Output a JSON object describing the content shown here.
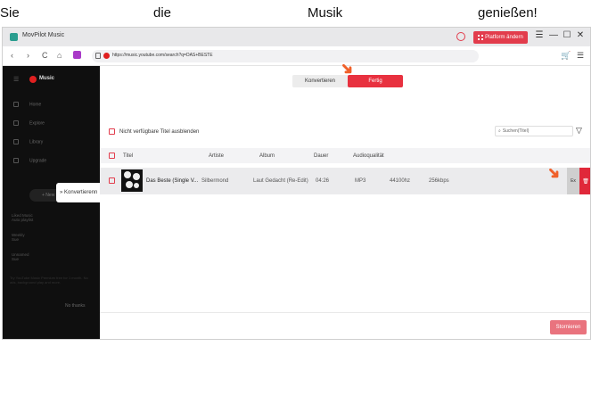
{
  "captions": [
    "Sie",
    "die",
    "Musik",
    "genießen!"
  ],
  "app": {
    "title": "MovPilot Music",
    "platform_button": "Platform ändern"
  },
  "window_controls": {
    "menu": "☰",
    "minimize": "—",
    "maximize": "☐",
    "close": "✕"
  },
  "browser": {
    "back": "‹",
    "forward": "›",
    "reload": "C",
    "home": "⌂",
    "url": "https://music.youtube.com/search?q=DAS+BESTE",
    "cart": "🛒",
    "queue": "☰"
  },
  "sidebar": {
    "logo": "Music",
    "items": [
      "Home",
      "Explore",
      "Library",
      "Upgrade"
    ],
    "new_playlist": "+ New",
    "lists": [
      {
        "title": "Liked Music",
        "sub": "Auto playlist"
      },
      {
        "title": "Weekly",
        "sub": "Sue"
      },
      {
        "title": "Unnamed",
        "sub": "Sue"
      }
    ],
    "note": "Try YouTube Music Premium free for 1 month. No ads, background play and more.",
    "play": "No thanks",
    "tooltip": "Konvertierenn"
  },
  "tabs": {
    "convert": "Konvertieren",
    "done": "Fertig"
  },
  "toolbar": {
    "hide_unavailable": "Nicht verfügbare Titel ausblenden",
    "search_placeholder": "Suchen(Titel)"
  },
  "table": {
    "headers": [
      "Titel",
      "Artiste",
      "Album",
      "Dauer",
      "Audioqualität"
    ],
    "rows": [
      {
        "title": "Das Beste (Single V...",
        "artist": "Silbermond",
        "album": "Laut Gedacht (Re-Edit)",
        "duration": "04:26",
        "format": "MP3",
        "sample_rate": "44100hz",
        "bitrate": "256kbps",
        "action": "Ex",
        "delete": "🗑"
      }
    ]
  },
  "footer": {
    "cancel": "Stornieren"
  },
  "colors": {
    "accent": "#e8313f",
    "arrow": "#f0602a"
  }
}
